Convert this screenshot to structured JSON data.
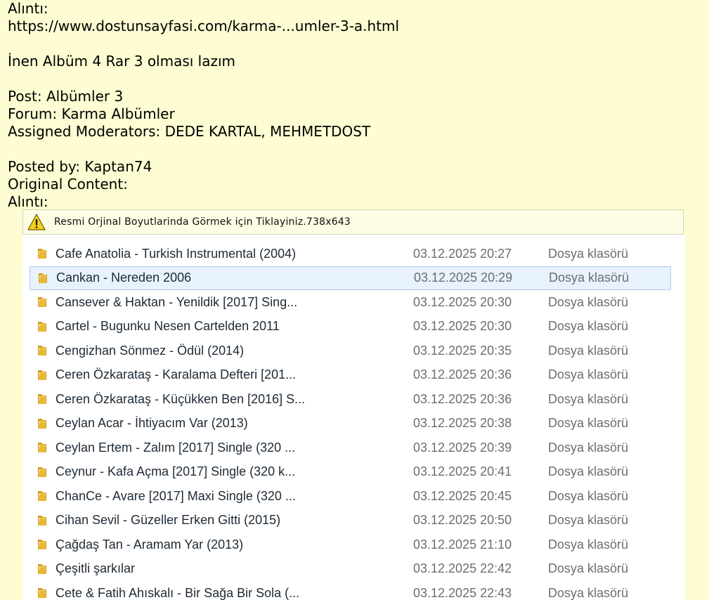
{
  "post": {
    "quote_label_1": "Alıntı:",
    "quote_url": "https://www.dostunsayfasi.com/karma-...umler-3-a.html",
    "message": "İnen Albüm 4 Rar 3 olması lazım",
    "post_line": "Post: Albümler 3",
    "forum_line": "Forum: Karma Albümler",
    "moderators_line": "Assigned Moderators: DEDE KARTAL, MEHMETDOST",
    "posted_by_line": "Posted by: Kaptan74",
    "original_content_label": "Original Content:",
    "quote_label_2": "Alıntı:"
  },
  "image_notice": {
    "text": "Resmi Orjinal Boyutlarinda Görmek için Tiklayiniz.738x643",
    "icon": "warning-icon"
  },
  "explorer": {
    "rows": [
      {
        "name": "Cafe Anatolia - Turkish Instrumental (2004)",
        "date": "03.12.2025 20:27",
        "type": "Dosya klasörü"
      },
      {
        "name": "Cankan - Nereden 2006",
        "date": "03.12.2025 20:29",
        "type": "Dosya klasörü"
      },
      {
        "name": "Cansever & Haktan - Yenildik [2017] Sing...",
        "date": "03.12.2025 20:30",
        "type": "Dosya klasörü"
      },
      {
        "name": "Cartel - Bugunku Nesen Cartelden 2011",
        "date": "03.12.2025 20:30",
        "type": "Dosya klasörü"
      },
      {
        "name": "Cengizhan Sönmez - Ödül (2014)",
        "date": "03.12.2025 20:35",
        "type": "Dosya klasörü"
      },
      {
        "name": "Ceren Özkarataş - Karalama Defteri [201...",
        "date": "03.12.2025 20:36",
        "type": "Dosya klasörü"
      },
      {
        "name": "Ceren Özkarataş - Küçükken Ben [2016] S...",
        "date": "03.12.2025 20:36",
        "type": "Dosya klasörü"
      },
      {
        "name": "Ceylan Acar - İhtiyacım Var (2013)",
        "date": "03.12.2025 20:38",
        "type": "Dosya klasörü"
      },
      {
        "name": "Ceylan Ertem - Zalım [2017] Single (320 ...",
        "date": "03.12.2025 20:39",
        "type": "Dosya klasörü"
      },
      {
        "name": "Ceynur - Kafa Açma [2017] Single (320 k...",
        "date": "03.12.2025 20:41",
        "type": "Dosya klasörü"
      },
      {
        "name": "ChanCe - Avare [2017] Maxi Single (320 ...",
        "date": "03.12.2025 20:45",
        "type": "Dosya klasörü"
      },
      {
        "name": "Cihan Sevil - Güzeller Erken Gitti (2015)",
        "date": "03.12.2025 20:50",
        "type": "Dosya klasörü"
      },
      {
        "name": "Çağdaş Tan - Aramam Yar (2013)",
        "date": "03.12.2025 21:10",
        "type": "Dosya klasörü"
      },
      {
        "name": "Çeşitli şarkılar",
        "date": "03.12.2025 22:42",
        "type": "Dosya klasörü"
      },
      {
        "name": "Cete & Fatih Ahıskalı - Bir Sağa Bir Sola (...",
        "date": "03.12.2025 22:43",
        "type": "Dosya klasörü"
      }
    ],
    "selected_index": 1,
    "folder_icon": "folder-icon",
    "colors": {
      "folder": "#e8b83a",
      "selected_bg": "#e8f2fd",
      "selected_border": "#a9cbee"
    }
  }
}
